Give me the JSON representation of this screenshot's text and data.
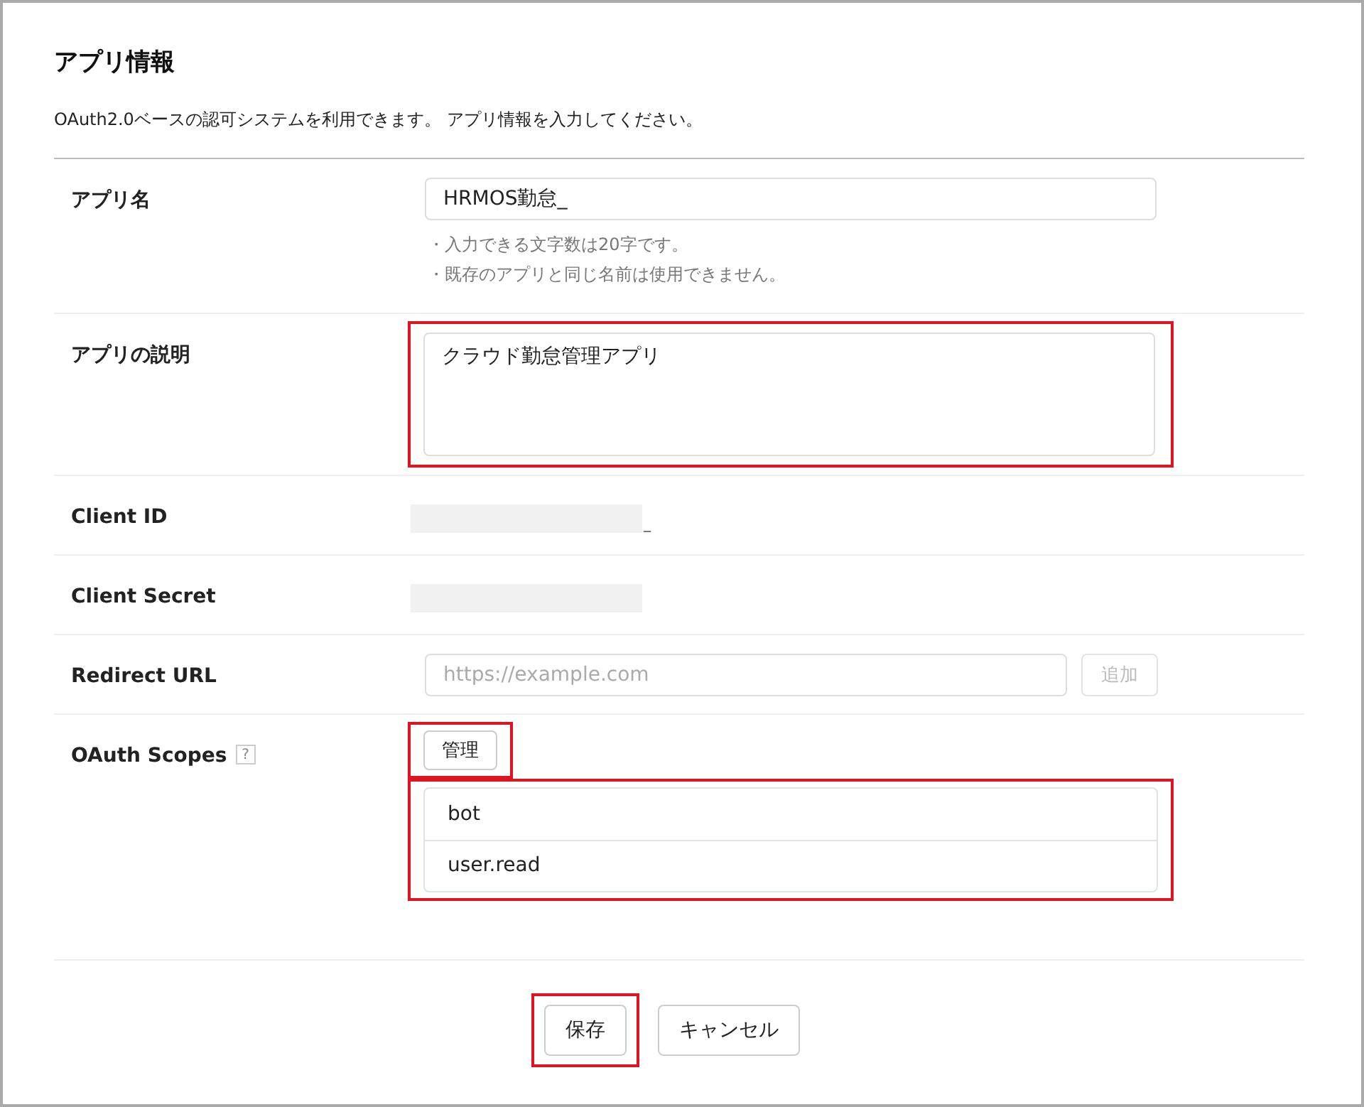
{
  "title": "アプリ情報",
  "description": "OAuth2.0ベースの認可システムを利用できます。 アプリ情報を入力してください。",
  "fields": [
    {
      "kind": "text",
      "label": "アプリ名",
      "value": "HRMOS勤怠_",
      "notes": [
        "・入力できる文字数は20字です。",
        "・既存のアプリと同じ名前は使用できません。"
      ]
    },
    {
      "kind": "textarea",
      "label": "アプリの説明",
      "value": "クラウド勤怠管理アプリ",
      "highlighted": true
    },
    {
      "kind": "redacted",
      "label": "Client ID",
      "suffix": "_"
    },
    {
      "kind": "redacted",
      "label": "Client Secret"
    },
    {
      "kind": "url",
      "label": "Redirect URL",
      "placeholder": "https://example.com",
      "button": "追加",
      "button_disabled": true
    },
    {
      "kind": "scopes",
      "label": "OAuth Scopes",
      "help": "?",
      "button": "管理",
      "button_highlighted": true,
      "scopes": [
        "bot",
        "user.read"
      ],
      "highlighted": true
    }
  ],
  "actions": [
    {
      "label": "保存",
      "highlighted": true
    },
    {
      "label": "キャンセル",
      "highlighted": false
    }
  ]
}
